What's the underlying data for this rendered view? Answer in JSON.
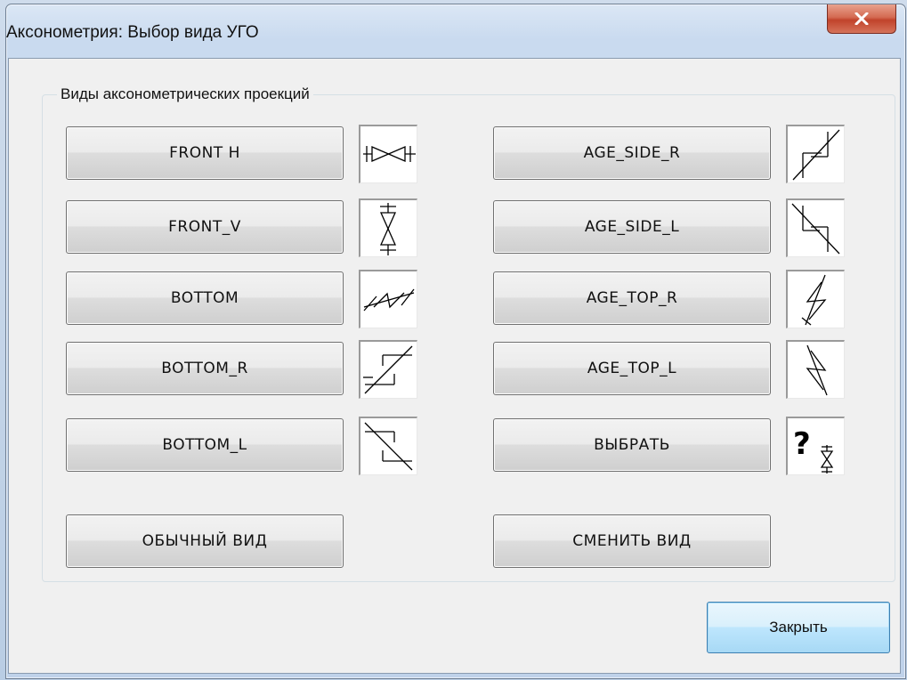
{
  "window": {
    "title": "Аксонометрия: Выбор вида УГО"
  },
  "group": {
    "label": "Виды аксонометрических проекций"
  },
  "buttons": {
    "front_h": "FRONT H",
    "front_v": "FRONT_V",
    "bottom": "BOTTOM",
    "bottom_r": "BOTTOM_R",
    "bottom_l": "BOTTOM_L",
    "age_side_r": "AGE_SIDE_R",
    "age_side_l": "AGE_SIDE_L",
    "age_top_r": "AGE_TOP_R",
    "age_top_l": "AGE_TOP_L",
    "choose": "ВЫБРАТЬ",
    "normal_view": "ОБЫЧНЫЙ ВИД",
    "change_view": "СМЕНИТЬ ВИД",
    "close": "Закрыть"
  },
  "icons": {
    "front_h": "valve-horizontal-icon",
    "front_v": "valve-vertical-icon",
    "bottom": "valve-iso-bottom-icon",
    "bottom_r": "valve-iso-bottom-right-icon",
    "bottom_l": "valve-iso-bottom-left-icon",
    "age_side_r": "valve-iso-side-right-icon",
    "age_side_l": "valve-iso-side-left-icon",
    "age_top_r": "valve-iso-top-right-icon",
    "age_top_l": "valve-iso-top-left-icon",
    "choose": "question-valve-icon",
    "question_mark": "?"
  },
  "colors": {
    "close_button_red": "#c1432b",
    "default_button_blue": "#3c7fb1"
  }
}
